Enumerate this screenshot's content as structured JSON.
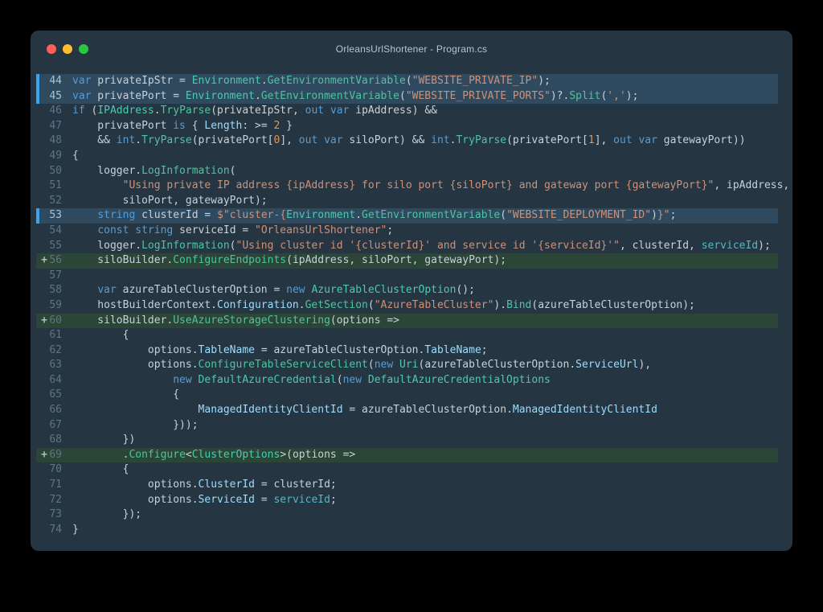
{
  "window": {
    "title": "OrleansUrlShortener - Program.cs"
  },
  "palette": {
    "page-bg": "#000000",
    "window-bg": "#253642",
    "titlebar-text": "#bac4cd",
    "gutter": "#5d7585",
    "gutter-active": "#a9c3d6",
    "code-plain": "#c7d1da",
    "tok-kw": "#569cd6",
    "tok-ty": "#4ec9b0",
    "tok-fn": "#4fc3a1",
    "tok-pr": "#9cdcfe",
    "tok-cn": "#56b6c2",
    "tok-str": "#ce9178",
    "tok-num": "#d19a66",
    "sel-bg": "#2f4a5e",
    "accent": "#3ba3f0",
    "add-bg": "#2b4536",
    "add-marker": "#aebfb3",
    "light-close": "#ff5f57",
    "light-min": "#febc2e",
    "light-max": "#28c840"
  },
  "editor": {
    "lines": [
      {
        "n": "44",
        "hl": "sel",
        "m": "",
        "t": [
          [
            "kw",
            "var"
          ],
          [
            "pl",
            " privateIpStr = "
          ],
          [
            "ty",
            "Environment"
          ],
          [
            "pl",
            "."
          ],
          [
            "fn",
            "GetEnvironmentVariable"
          ],
          [
            "pl",
            "("
          ],
          [
            "str",
            "\"WEBSITE_PRIVATE_IP\""
          ],
          [
            "pl",
            ");"
          ]
        ]
      },
      {
        "n": "45",
        "hl": "sel",
        "m": "",
        "t": [
          [
            "kw",
            "var"
          ],
          [
            "pl",
            " privatePort = "
          ],
          [
            "ty",
            "Environment"
          ],
          [
            "pl",
            "."
          ],
          [
            "fn",
            "GetEnvironmentVariable"
          ],
          [
            "pl",
            "("
          ],
          [
            "str",
            "\"WEBSITE_PRIVATE_PORTS\""
          ],
          [
            "pl",
            ")?."
          ],
          [
            "fn",
            "Split"
          ],
          [
            "pl",
            "("
          ],
          [
            "str",
            "','"
          ],
          [
            "pl",
            ");"
          ]
        ]
      },
      {
        "n": "46",
        "hl": "",
        "m": "",
        "t": [
          [
            "kw",
            "if"
          ],
          [
            "pl",
            " ("
          ],
          [
            "ty",
            "IPAddress"
          ],
          [
            "pl",
            "."
          ],
          [
            "fn",
            "TryParse"
          ],
          [
            "pl",
            "(privateIpStr, "
          ],
          [
            "kw",
            "out"
          ],
          [
            "pl",
            " "
          ],
          [
            "kw",
            "var"
          ],
          [
            "pl",
            " ipAddress) &&"
          ]
        ]
      },
      {
        "n": "47",
        "hl": "",
        "m": "",
        "t": [
          [
            "pl",
            "    privatePort "
          ],
          [
            "kw",
            "is"
          ],
          [
            "pl",
            " { "
          ],
          [
            "pr",
            "Length"
          ],
          [
            "pl",
            ": >= "
          ],
          [
            "num",
            "2"
          ],
          [
            "pl",
            " }"
          ]
        ]
      },
      {
        "n": "48",
        "hl": "",
        "m": "",
        "t": [
          [
            "pl",
            "    && "
          ],
          [
            "kw",
            "int"
          ],
          [
            "pl",
            "."
          ],
          [
            "fn",
            "TryParse"
          ],
          [
            "pl",
            "(privatePort["
          ],
          [
            "num",
            "0"
          ],
          [
            "pl",
            "], "
          ],
          [
            "kw",
            "out"
          ],
          [
            "pl",
            " "
          ],
          [
            "kw",
            "var"
          ],
          [
            "pl",
            " siloPort) && "
          ],
          [
            "kw",
            "int"
          ],
          [
            "pl",
            "."
          ],
          [
            "fn",
            "TryParse"
          ],
          [
            "pl",
            "(privatePort["
          ],
          [
            "num",
            "1"
          ],
          [
            "pl",
            "], "
          ],
          [
            "kw",
            "out"
          ],
          [
            "pl",
            " "
          ],
          [
            "kw",
            "var"
          ],
          [
            "pl",
            " gatewayPort))"
          ]
        ]
      },
      {
        "n": "49",
        "hl": "",
        "m": "",
        "t": [
          [
            "pl",
            "{"
          ]
        ]
      },
      {
        "n": "50",
        "hl": "",
        "m": "",
        "t": [
          [
            "pl",
            "    logger."
          ],
          [
            "fn",
            "LogInformation"
          ],
          [
            "pl",
            "("
          ]
        ]
      },
      {
        "n": "51",
        "hl": "",
        "m": "",
        "t": [
          [
            "pl",
            "        "
          ],
          [
            "str",
            "\"Using private IP address {ipAddress} for silo port {siloPort} and gateway port {gatewayPort}\""
          ],
          [
            "pl",
            ", ipAddress,"
          ]
        ]
      },
      {
        "n": "52",
        "hl": "",
        "m": "",
        "t": [
          [
            "pl",
            "        siloPort, gatewayPort);"
          ]
        ]
      },
      {
        "n": "53",
        "hl": "sel",
        "m": "",
        "t": [
          [
            "pl",
            "    "
          ],
          [
            "kw",
            "string"
          ],
          [
            "pl",
            " clusterId = "
          ],
          [
            "str",
            "$\"cluster-{"
          ],
          [
            "ty",
            "Environment"
          ],
          [
            "pl",
            "."
          ],
          [
            "fn",
            "GetEnvironmentVariable"
          ],
          [
            "pl",
            "("
          ],
          [
            "str",
            "\"WEBSITE_DEPLOYMENT_ID\""
          ],
          [
            "pl",
            ")"
          ],
          [
            "str",
            "}\""
          ],
          [
            "pl",
            ";"
          ]
        ]
      },
      {
        "n": "54",
        "hl": "",
        "m": "",
        "t": [
          [
            "pl",
            "    "
          ],
          [
            "kw",
            "const"
          ],
          [
            "pl",
            " "
          ],
          [
            "kw",
            "string"
          ],
          [
            "pl",
            " serviceId = "
          ],
          [
            "str",
            "\"OrleansUrlShortener\""
          ],
          [
            "pl",
            ";"
          ]
        ]
      },
      {
        "n": "55",
        "hl": "",
        "m": "",
        "t": [
          [
            "pl",
            "    logger."
          ],
          [
            "fn",
            "LogInformation"
          ],
          [
            "pl",
            "("
          ],
          [
            "str",
            "\"Using cluster id '{clusterId}' and service id '{serviceId}'\""
          ],
          [
            "pl",
            ", clusterId, "
          ],
          [
            "cn",
            "serviceId"
          ],
          [
            "pl",
            ");"
          ]
        ]
      },
      {
        "n": "56",
        "hl": "add",
        "m": "+",
        "t": [
          [
            "pl",
            "    siloBuilder."
          ],
          [
            "fn",
            "ConfigureEndpoints"
          ],
          [
            "pl",
            "(ipAddress, siloPort, gatewayPort);"
          ]
        ]
      },
      {
        "n": "57",
        "hl": "",
        "m": "",
        "t": []
      },
      {
        "n": "58",
        "hl": "",
        "m": "",
        "t": [
          [
            "pl",
            "    "
          ],
          [
            "kw",
            "var"
          ],
          [
            "pl",
            " azureTableClusterOption = "
          ],
          [
            "kw",
            "new"
          ],
          [
            "pl",
            " "
          ],
          [
            "ty",
            "AzureTableClusterOption"
          ],
          [
            "pl",
            "();"
          ]
        ]
      },
      {
        "n": "59",
        "hl": "",
        "m": "",
        "t": [
          [
            "pl",
            "    hostBuilderContext."
          ],
          [
            "pr",
            "Configuration"
          ],
          [
            "pl",
            "."
          ],
          [
            "fn",
            "GetSection"
          ],
          [
            "pl",
            "("
          ],
          [
            "str",
            "\"AzureTableCluster\""
          ],
          [
            "pl",
            ")."
          ],
          [
            "fn",
            "Bind"
          ],
          [
            "pl",
            "(azureTableClusterOption);"
          ]
        ]
      },
      {
        "n": "60",
        "hl": "add",
        "m": "+",
        "t": [
          [
            "pl",
            "    siloBuilder."
          ],
          [
            "fn",
            "UseAzureStorageClustering"
          ],
          [
            "pl",
            "(options =>"
          ]
        ]
      },
      {
        "n": "61",
        "hl": "",
        "m": "",
        "t": [
          [
            "pl",
            "        {"
          ]
        ]
      },
      {
        "n": "62",
        "hl": "",
        "m": "",
        "t": [
          [
            "pl",
            "            options."
          ],
          [
            "pr",
            "TableName"
          ],
          [
            "pl",
            " = azureTableClusterOption."
          ],
          [
            "pr",
            "TableName"
          ],
          [
            "pl",
            ";"
          ]
        ]
      },
      {
        "n": "63",
        "hl": "",
        "m": "",
        "t": [
          [
            "pl",
            "            options."
          ],
          [
            "fn",
            "ConfigureTableServiceClient"
          ],
          [
            "pl",
            "("
          ],
          [
            "kw",
            "new"
          ],
          [
            "pl",
            " "
          ],
          [
            "ty",
            "Uri"
          ],
          [
            "pl",
            "(azureTableClusterOption."
          ],
          [
            "pr",
            "ServiceUrl"
          ],
          [
            "pl",
            "),"
          ]
        ]
      },
      {
        "n": "64",
        "hl": "",
        "m": "",
        "t": [
          [
            "pl",
            "                "
          ],
          [
            "kw",
            "new"
          ],
          [
            "pl",
            " "
          ],
          [
            "ty",
            "DefaultAzureCredential"
          ],
          [
            "pl",
            "("
          ],
          [
            "kw",
            "new"
          ],
          [
            "pl",
            " "
          ],
          [
            "ty",
            "DefaultAzureCredentialOptions"
          ]
        ]
      },
      {
        "n": "65",
        "hl": "",
        "m": "",
        "t": [
          [
            "pl",
            "                {"
          ]
        ]
      },
      {
        "n": "66",
        "hl": "",
        "m": "",
        "t": [
          [
            "pl",
            "                    "
          ],
          [
            "pr",
            "ManagedIdentityClientId"
          ],
          [
            "pl",
            " = azureTableClusterOption."
          ],
          [
            "pr",
            "ManagedIdentityClientId"
          ]
        ]
      },
      {
        "n": "67",
        "hl": "",
        "m": "",
        "t": [
          [
            "pl",
            "                }));"
          ]
        ]
      },
      {
        "n": "68",
        "hl": "",
        "m": "",
        "t": [
          [
            "pl",
            "        })"
          ]
        ]
      },
      {
        "n": "69",
        "hl": "add",
        "m": "+",
        "t": [
          [
            "pl",
            "        ."
          ],
          [
            "fn",
            "Configure"
          ],
          [
            "pl",
            "<"
          ],
          [
            "ty",
            "ClusterOptions"
          ],
          [
            "pl",
            ">(options =>"
          ]
        ]
      },
      {
        "n": "70",
        "hl": "",
        "m": "",
        "t": [
          [
            "pl",
            "        {"
          ]
        ]
      },
      {
        "n": "71",
        "hl": "",
        "m": "",
        "t": [
          [
            "pl",
            "            options."
          ],
          [
            "pr",
            "ClusterId"
          ],
          [
            "pl",
            " = clusterId;"
          ]
        ]
      },
      {
        "n": "72",
        "hl": "",
        "m": "",
        "t": [
          [
            "pl",
            "            options."
          ],
          [
            "pr",
            "ServiceId"
          ],
          [
            "pl",
            " = "
          ],
          [
            "cn",
            "serviceId"
          ],
          [
            "pl",
            ";"
          ]
        ]
      },
      {
        "n": "73",
        "hl": "",
        "m": "",
        "t": [
          [
            "pl",
            "        });"
          ]
        ]
      },
      {
        "n": "74",
        "hl": "",
        "m": "",
        "t": [
          [
            "pl",
            "}"
          ]
        ]
      }
    ]
  }
}
